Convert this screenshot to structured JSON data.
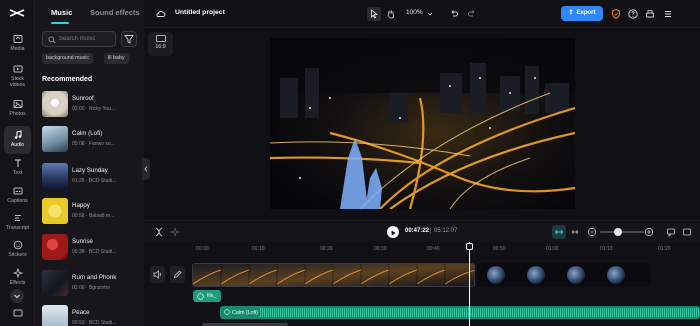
{
  "rail": {
    "items": [
      {
        "label": "Media",
        "icon": "media-icon"
      },
      {
        "label": "Stock videos",
        "icon": "stock-videos-icon"
      },
      {
        "label": "Photos",
        "icon": "photos-icon"
      },
      {
        "label": "Audio",
        "icon": "audio-icon"
      },
      {
        "label": "Text",
        "icon": "text-icon"
      },
      {
        "label": "Captions",
        "icon": "captions-icon"
      },
      {
        "label": "Transcript",
        "icon": "transcript-icon"
      },
      {
        "label": "Stickers",
        "icon": "stickers-icon"
      },
      {
        "label": "Effects",
        "icon": "effects-icon"
      }
    ]
  },
  "panel": {
    "tabs": [
      "Music",
      "Sound effects"
    ],
    "search_placeholder": "Search music",
    "chips": [
      "background music",
      "lil baby"
    ],
    "section_title": "Recommended",
    "tracks": [
      {
        "title": "Sunroof",
        "meta": "03:00 · Nicky You...",
        "color": "#d8d0c2"
      },
      {
        "title": "Calm (Lofi)",
        "meta": "05:08 · Fanwo so...",
        "color": "#9ab7c6"
      },
      {
        "title": "Lazy Sunday",
        "meta": "01:26 · BCD Studi...",
        "color": "#3c4d7a"
      },
      {
        "title": "Happy",
        "meta": "00:56 · Babadi m...",
        "color": "#e9c928"
      },
      {
        "title": "Sunrise",
        "meta": "00:38 · BCD Studi...",
        "color": "#9c1a1a"
      },
      {
        "title": "Rum and Phonk",
        "meta": "03:00 · Bgnzinho",
        "color": "#1a1f2a"
      },
      {
        "title": "Peace",
        "meta": "00:53 · BCD Studi...",
        "color": "#b7c9d9"
      }
    ]
  },
  "topbar": {
    "project_title": "Untitled project",
    "zoom": "100%",
    "export_label": "Export"
  },
  "preview": {
    "aspect_label": "16:9"
  },
  "timeline": {
    "current_time": "00:47:22",
    "total_time": "05:12:07",
    "ticks": [
      "00:00",
      "00:10",
      "00:20",
      "00:30",
      "00:40",
      "00:50",
      "01:00",
      "01:10",
      "01:20"
    ],
    "file_clip_label": "file_",
    "audio_clip_label": "Calm (Lofi)"
  },
  "colors": {
    "accent": "#2fd3dd",
    "export": "#2f86f6",
    "audio_clip": "#18896f"
  }
}
